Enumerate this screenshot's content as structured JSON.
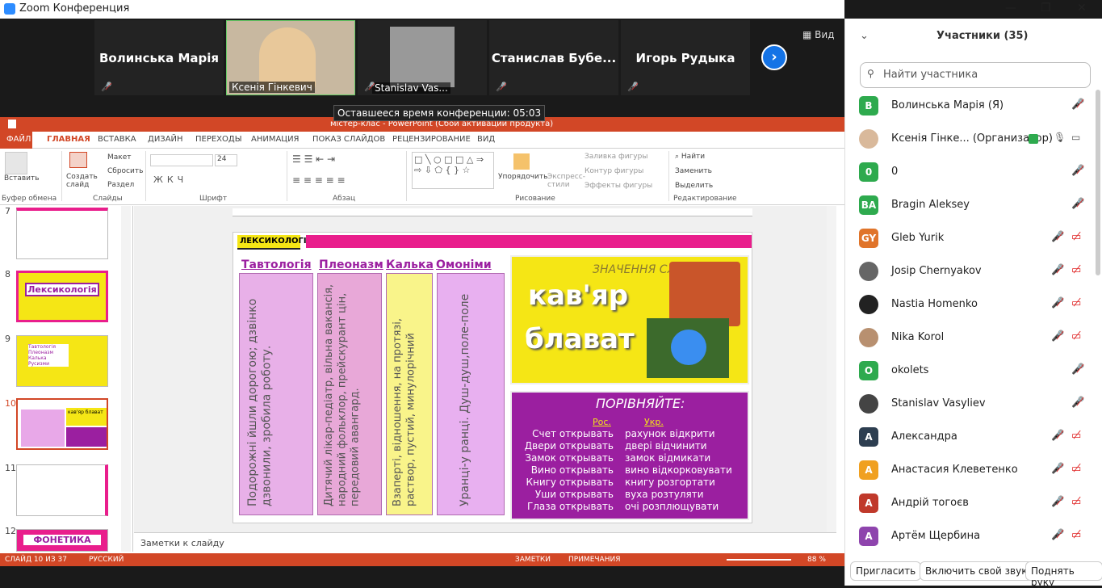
{
  "window": {
    "title": "Zoom Конференция",
    "minimize": "—",
    "restore": "❐",
    "close": "✕"
  },
  "video": {
    "tiles": [
      {
        "name": "Волинська Марія"
      },
      {
        "label": "Ксенія Гінкевич"
      },
      {
        "label": "Stanislav Vas..."
      },
      {
        "name": "Станислав  Бубе..."
      },
      {
        "name": "Игорь Рудыка"
      }
    ],
    "view_label": "Вид",
    "timer": "Оставшееся время конференции: 05:03"
  },
  "ppt": {
    "title": "містер-клас  - PowerPoint (Сбой активации продукта)",
    "tabs": [
      "ФАЙЛ",
      "ГЛАВНАЯ",
      "ВСТАВКА",
      "ДИЗАЙН",
      "ПЕРЕХОДЫ",
      "АНИМАЦИЯ",
      "ПОКАЗ СЛАЙДОВ",
      "РЕЦЕНЗИРОВАНИЕ",
      "ВИД"
    ],
    "ribbon": {
      "paste": "Вставить",
      "clipboard": "Буфер обмена",
      "create": "Создать слайд",
      "layout": "Макет",
      "reset": "Сбросить",
      "section": "Раздел",
      "slides": "Слайды",
      "font_size": "24",
      "font": "Шрифт",
      "para": "Абзац",
      "arrange": "Упорядочить",
      "styles": "Экспресс-стили",
      "fill": "Заливка фигуры",
      "outline": "Контур фигуры",
      "effects": "Эффекты фигуры",
      "drawing": "Рисование",
      "find": "Найти",
      "replace": "Заменить",
      "select": "Выделить",
      "editing": "Редактирование"
    },
    "thumbs": [
      {
        "num": "7"
      },
      {
        "num": "8",
        "text": "Лексикологія"
      },
      {
        "num": "9",
        "text": "Тавтологія Плеоназм Калька Русизми"
      },
      {
        "num": "10",
        "text": "кав'яр блават"
      },
      {
        "num": "11"
      },
      {
        "num": "12",
        "text": "ФОНЕТИКА"
      }
    ],
    "slide": {
      "tag": "ЛЕКСИКОЛОГІЯ",
      "headers": [
        "Тавтологія",
        "Плеоназм",
        "Калька",
        "Омоніми"
      ],
      "columns": [
        "Подорожні йшли дорогою; дзвінко дзвонили, зробила роботу.",
        "Дитячий лікар-педіатр, вільна вакансія, народний фольклор, прейскурант цін, передовий авангард.",
        "Взаперті, відношення, на протязі, раствор, пустий, минулорічний",
        "Уранці-у ранці. Душ-душ,поле-поле"
      ],
      "meaning_title": "ЗНАЧЕННЯ СЛІВ",
      "word1": "кав'яр",
      "word2": "блават",
      "compare_title": "ПОРІВНЯЙТЕ:",
      "compare_ru": "Рос.",
      "compare_uk": "Укр.",
      "pairs": [
        [
          "Счет открывать",
          "рахунок відкрити"
        ],
        [
          "Двери открывать",
          "двері відчинити"
        ],
        [
          "Замок открывать",
          "замок відмикати"
        ],
        [
          "Вино открывать",
          "вино відкорковувати"
        ],
        [
          "Книгу открывать",
          "книгу розгортати"
        ],
        [
          "Уши открывать",
          "вуха розтуляти"
        ],
        [
          "Глаза открывать",
          "очі розплющувати"
        ]
      ]
    },
    "notes": "Заметки к слайду",
    "status": {
      "slide": "СЛАЙД 10 ИЗ 37",
      "lang": "РУССКИЙ",
      "notes": "ЗАМЕТКИ",
      "comments": "ПРИМЕЧАНИЯ",
      "zoom": "88 %"
    }
  },
  "panel": {
    "title": "Участники (35)",
    "search_placeholder": "Найти участника",
    "participants": [
      {
        "initials": "В",
        "name": "Волинська Марія (Я)",
        "color": "#2eaa4e",
        "video": false
      },
      {
        "initials": "",
        "name": "Ксенія Гінке... (Организатор)",
        "color": "#d9b99b",
        "video": true
      },
      {
        "initials": "0",
        "name": "0",
        "color": "#2eaa4e",
        "video": false
      },
      {
        "initials": "BA",
        "name": "Bragin Aleksey",
        "color": "#2eaa4e",
        "video": false
      },
      {
        "initials": "GY",
        "name": "Gleb Yurik",
        "color": "#e0742a",
        "video": true
      },
      {
        "initials": "",
        "name": "Josip Chernyakov",
        "color": "#666666",
        "video": true
      },
      {
        "initials": "",
        "name": "Nastia Homenko",
        "color": "#222222",
        "video": true
      },
      {
        "initials": "",
        "name": "Nika Korol",
        "color": "#b89070",
        "video": true
      },
      {
        "initials": "O",
        "name": "okolets",
        "color": "#2eaa4e",
        "video": false
      },
      {
        "initials": "",
        "name": "Stanislav Vasyliev",
        "color": "#444444",
        "video": false
      },
      {
        "initials": "А",
        "name": "Александра",
        "color": "#2d3e50",
        "video": true
      },
      {
        "initials": "А",
        "name": "Анастасия Клеветенко",
        "color": "#f0a020",
        "video": true
      },
      {
        "initials": "А",
        "name": "Андрій тогоєв",
        "color": "#c0392b",
        "video": true
      },
      {
        "initials": "А",
        "name": "Артём Щербина",
        "color": "#8e44ad",
        "video": true
      }
    ],
    "invite": "Пригласить",
    "unmute": "Включить свой звук",
    "raise": "Поднять руку"
  }
}
